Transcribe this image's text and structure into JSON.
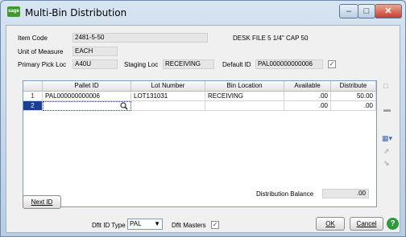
{
  "window": {
    "title": "Multi-Bin Distribution",
    "icon": "sage-app-icon"
  },
  "header": {
    "item_code_label": "Item Code",
    "item_code": "2481-5-50",
    "item_desc": "DESK FILE 5 1/4\" CAP 50",
    "uom_label": "Unit of Measure",
    "uom": "EACH",
    "primary_pick_label": "Primary Pick Loc",
    "primary_pick": "A40U",
    "staging_label": "Staging Loc",
    "staging": "RECEIVING",
    "default_id_label": "Default ID",
    "default_id": "PAL000000000006",
    "default_id_checked": true
  },
  "grid": {
    "columns": [
      "",
      "Pallet ID",
      "Lot Number",
      "Bin Location",
      "Available",
      "Distribute"
    ],
    "rows": [
      {
        "num": "1",
        "pallet": "PAL000000000006",
        "lot": "LOT131031",
        "bin": "RECEIVING",
        "available": ".00",
        "distribute": "50.00"
      },
      {
        "num": "2",
        "pallet": "",
        "lot": "",
        "bin": "",
        "available": ".00",
        "distribute": ".00"
      }
    ]
  },
  "footer": {
    "next_id": "Next ID",
    "dist_balance_label": "Distribution Balance",
    "dist_balance": ".00",
    "dflt_id_type_label": "Dflt ID Type",
    "dflt_id_type": "PAL",
    "dflt_masters_label": "Dflt Masters",
    "dflt_masters_checked": true,
    "ok": "OK",
    "cancel": "Cancel"
  },
  "colors": {
    "selected_row": "#1c3f94",
    "title_bar": "#c7d8ec",
    "close": "#c4402a"
  }
}
